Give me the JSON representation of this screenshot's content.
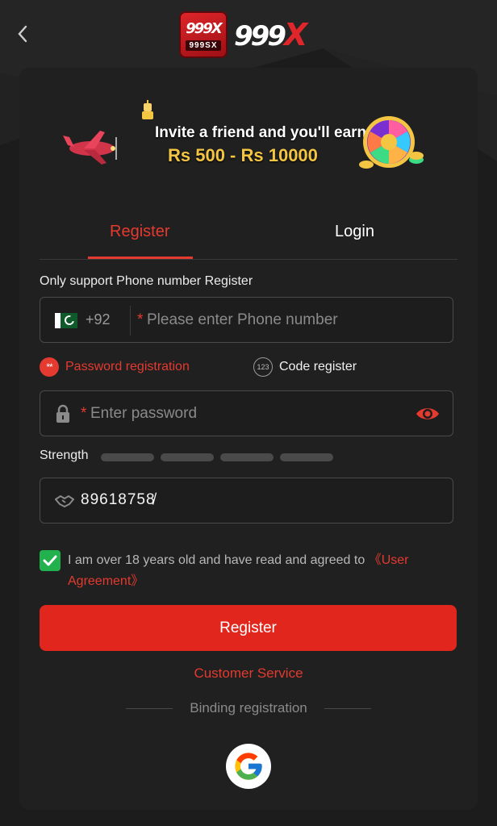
{
  "header": {
    "logo_box_text": "999X",
    "logo_box_sub": "999SX",
    "logo_word": "999",
    "logo_word_x": "X"
  },
  "banner": {
    "line1": "Invite a friend and you'll earn",
    "line2": "Rs 500 - Rs 10000"
  },
  "tabs": {
    "register": "Register",
    "login": "Login"
  },
  "form": {
    "support_label": "Only support Phone number Register",
    "phone_prefix": "+92",
    "phone_placeholder": "Please enter Phone number",
    "required_mark": "*",
    "mode_password": "Password registration",
    "mode_password_badge": "**",
    "mode_code": "Code register",
    "mode_code_badge": "123",
    "password_placeholder": "Enter password",
    "strength_label": "Strength",
    "invite_code": "89618758̸"
  },
  "agreement": {
    "text": "I am over 18 years old and have read and agreed to ",
    "link": "《User Agreement》",
    "checked": true
  },
  "actions": {
    "register": "Register",
    "customer_service": "Customer Service",
    "binding": "Binding registration"
  },
  "colors": {
    "accent": "#e43a2f",
    "button": "#e0261d",
    "check": "#22b14c",
    "banner_gold": "#f4c542"
  }
}
